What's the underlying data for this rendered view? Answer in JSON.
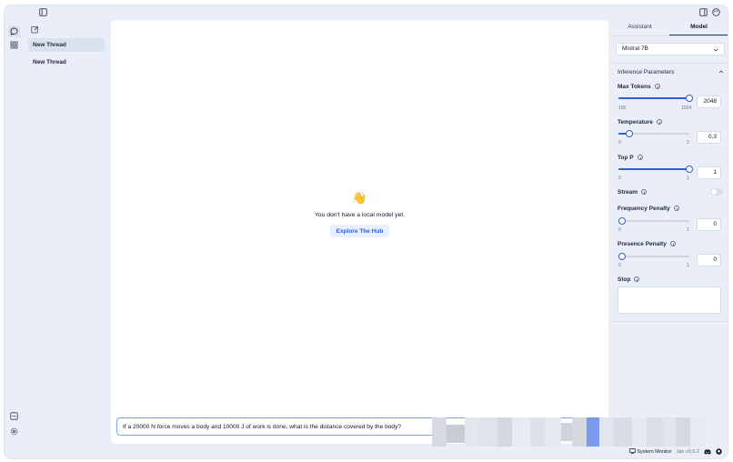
{
  "threads": {
    "items": [
      {
        "label": "New Thread",
        "selected": true
      },
      {
        "label": "New Thread",
        "selected": false
      }
    ]
  },
  "main": {
    "emoji": "👋",
    "empty_message": "You don't have a local model yet.",
    "explore_button": "Explore The Hub",
    "chat_input_value": "If a 20000 N force moves a body and 10000 J of work is done, what is the distance covered by the body?"
  },
  "right_panel": {
    "tabs": [
      {
        "label": "Assistant",
        "active": false
      },
      {
        "label": "Model",
        "active": true
      }
    ],
    "model_select": "Mistral 7B",
    "section_title": "Inference Parameters",
    "max_tokens": {
      "label": "Max Tokens",
      "min": "100",
      "max": "1024",
      "value": "2048",
      "slider_fraction": 1.0
    },
    "temperature": {
      "label": "Temperature",
      "min": "0",
      "max": "2",
      "value": "0,3",
      "slider_fraction": 0.15
    },
    "top_p": {
      "label": "Top P",
      "min": "0",
      "max": "1",
      "value": "1",
      "slider_fraction": 1.0
    },
    "stream": {
      "label": "Stream",
      "on": false
    },
    "frequency_penalty": {
      "label": "Frequency Penalty",
      "min": "0",
      "max": "1",
      "value": "0",
      "slider_fraction": 0.0
    },
    "presence_penalty": {
      "label": "Presence Penalty",
      "min": "0",
      "max": "1",
      "value": "0",
      "slider_fraction": 0.0
    },
    "stop": {
      "label": "Stop",
      "value": ""
    }
  },
  "footer": {
    "system_monitor": "System Monitor",
    "version": "Jan v0.5.2"
  },
  "colors": {
    "accent": "#2f5fd0",
    "app_bg": "#e9eef8"
  }
}
